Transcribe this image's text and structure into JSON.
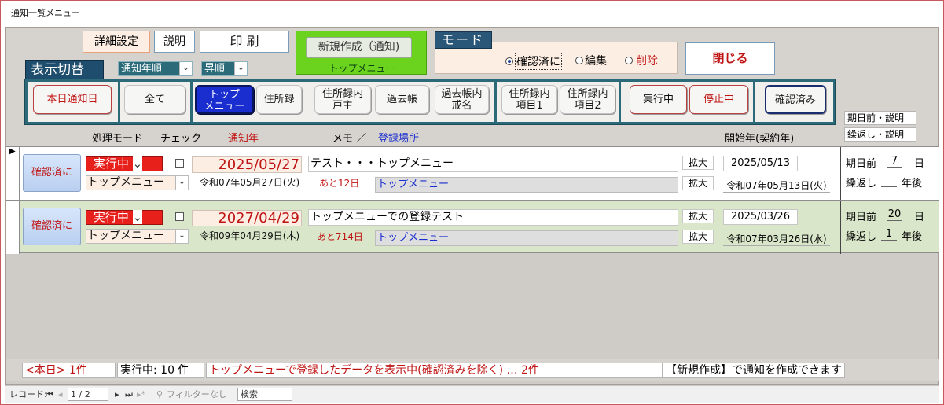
{
  "window": {
    "title": "通知一覧メニュー"
  },
  "header": {
    "detail_btn": "詳細設定",
    "explain_btn": "説明",
    "print_btn": "印 刷",
    "new_btn": "新規作成（通知)",
    "new_sub": "トップメニュー",
    "display_label": "表示切替",
    "sort_field": "通知年順",
    "sort_order": "昇順",
    "mode_label": "モード",
    "mode_options": [
      "確認済に",
      "編集",
      "削除"
    ],
    "mode_selected": "確認済に",
    "close_btn": "閉じる"
  },
  "tabs": {
    "today": "本日通知日",
    "all": "全て",
    "top_l1": "トップ",
    "top_l2": "メニュー",
    "address": "住所録",
    "household_l1": "住所録内",
    "household_l2": "戸主",
    "past": "過去帳",
    "posthumous_l1": "過去帳内",
    "posthumous_l2": "戒名",
    "item1_l1": "住所録内",
    "item1_l2": "項目1",
    "item2_l1": "住所録内",
    "item2_l2": "項目2",
    "running": "実行中",
    "stopped": "停止中",
    "confirmed": "確認済み"
  },
  "side_labels": {
    "before": "期日前・説明",
    "repeat": "繰返し・説明"
  },
  "columns": {
    "mode": "処理モード",
    "check": "チェック",
    "notify_year": "通知年",
    "memo": "メモ ／",
    "place": "登録場所",
    "start": "開始年(契約年)"
  },
  "records": [
    {
      "confirm": "確認済に",
      "status": "実行中",
      "location_sel": "トップメニュー",
      "date": "2025/05/27",
      "wareki": "令和07年05月27日(火)",
      "remain": "あと12日",
      "memo": "テスト・・・トップメニュー",
      "place": "トップメニュー",
      "expand": "拡大",
      "start_date": "2025/05/13",
      "start_wareki": "令和07年05月13日(火)",
      "before_label": "期日前",
      "before_val": "7",
      "day": "日",
      "repeat_label": "繰返し",
      "repeat_val": "",
      "year_after": "年後"
    },
    {
      "confirm": "確認済に",
      "status": "実行中",
      "location_sel": "トップメニュー",
      "date": "2027/04/29",
      "wareki": "令和09年04月29日(木)",
      "remain": "あと714日",
      "memo": "トップメニューでの登録テスト",
      "place": "トップメニュー",
      "expand": "拡大",
      "start_date": "2025/03/26",
      "start_wareki": "令和07年03月26日(水)",
      "before_label": "期日前",
      "before_val": "20",
      "day": "日",
      "repeat_label": "繰返し",
      "repeat_val": "1",
      "year_after": "年後"
    }
  ],
  "footer": {
    "today_count": "<本日> 1件",
    "running_count": "実行中: 10 件",
    "status_text": "トップメニューで登録したデータを表示中(確認済みを除く) … 2件",
    "hint": "【新規作成】で通知を作成できます"
  },
  "navbar": {
    "record_label": "レコード:",
    "record_pos": "1 / 2",
    "filter": "フィルターなし",
    "search": "検索"
  },
  "colors": {
    "accent_red": "#c01515",
    "dark_teal": "#2c6a7a",
    "green": "#6bd21d",
    "blue_active": "#1a2ed0"
  }
}
